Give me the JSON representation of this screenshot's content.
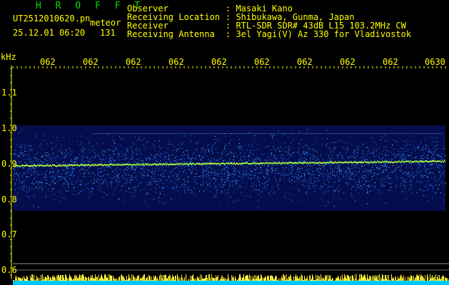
{
  "app": {
    "name": "H R O F F T"
  },
  "file": {
    "name": "UT2512010620.pn",
    "type": "meteor",
    "timestamp": "25.12.01 06:20",
    "count": "131"
  },
  "info": {
    "observer_label": "Observer",
    "observer_value": ": Masaki Kano",
    "location_label": "Receiving Location",
    "location_value": ": Shibukawa, Gunma, Japan",
    "receiver_label": "Receiver",
    "receiver_value": ": RTL-SDR SDR# 43dB L15 103.2MHz CW",
    "antenna_label": "Receiving Antenna",
    "antenna_value": ": 3el Yagi(V) Az 330 for Vladivostok"
  },
  "spectrogram": {
    "unit_label": "kHz",
    "y_ticks": [
      "1.1",
      "1.0",
      "0.9",
      "0.8",
      "0.7",
      "0.6"
    ],
    "time_ticks": [
      "062",
      "062",
      "062",
      "062",
      "062",
      "062",
      "062",
      "062",
      "062",
      "0630"
    ],
    "colors": {
      "background": "#000000",
      "noise_low": "#0a1a8a",
      "noise_mid": "#1e6cff",
      "signal": "#9cff3c",
      "signal_hot": "#ffff40",
      "axis": "#ffff00",
      "baseline": "#00c8ff"
    }
  }
}
